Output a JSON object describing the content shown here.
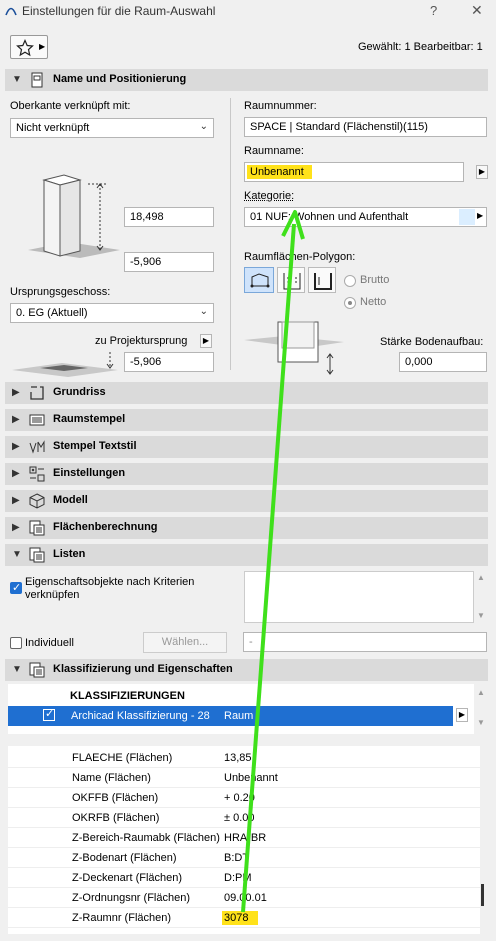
{
  "window": {
    "title": "Einstellungen für die Raum-Auswahl",
    "help": "?",
    "close": "✕"
  },
  "toolbar": {
    "selection_info": "Gewählt: 1 Bearbeitbar: 1"
  },
  "sections": {
    "name_pos": "Name und Positionierung",
    "grundriss": "Grundriss",
    "raumstempel": "Raumstempel",
    "stempel_textstil": "Stempel Textstil",
    "einstellungen": "Einstellungen",
    "modell": "Modell",
    "flaechenberechnung": "Flächenberechnung",
    "listen": "Listen",
    "klassifizierung": "Klassifizierung und Eigenschaften"
  },
  "name_pos": {
    "oberkante_label": "Oberkante verknüpft mit:",
    "oberkante_value": "Nicht verknüpft",
    "height_value": "18,498",
    "offset_value": "-5,906",
    "ursprung_label": "Ursprungsgeschoss:",
    "ursprung_value": "0. EG (Aktuell)",
    "projekt_label": "zu Projektursprung",
    "projekt_value": "-5,906",
    "raumnummer_label": "Raumnummer:",
    "raumnummer_value": "SPACE | Standard (Flächenstil)(115)",
    "raumname_label": "Raumname:",
    "raumname_value": "Unbenannt",
    "kategorie_label": "Kategorie:",
    "kategorie_value": "01 NUF: Wohnen und Aufenthalt",
    "polygon_label": "Raumflächen-Polygon:",
    "brutto_label": "Brutto",
    "netto_label": "Netto",
    "staerke_label": "Stärke Bodenaufbau:",
    "staerke_value": "0,000"
  },
  "listen": {
    "checkbox_label_1": "Eigenschaftsobjekte nach Kriterien",
    "checkbox_label_2": "verknüpfen",
    "individuell_label": "Individuell",
    "waehlen_label": "Wählen...",
    "dash_value": "-"
  },
  "klassifizierung": {
    "header": "KLASSIFIZIERUNGEN",
    "selected_name": "Archicad Klassifizierung - 28",
    "selected_value": "Raum",
    "properties": [
      {
        "name": "FLAECHE (Flächen)",
        "value": "13,85"
      },
      {
        "name": "Name (Flächen)",
        "value": "Unbenannt"
      },
      {
        "name": "OKFFB (Flächen)",
        "value": "+ 0.20"
      },
      {
        "name": "OKRFB (Flächen)",
        "value": "± 0.00"
      },
      {
        "name": "Z-Bereich-Raumabk (Flächen)",
        "value": "HRA-BR"
      },
      {
        "name": "Z-Bodenart (Flächen)",
        "value": "B:DT"
      },
      {
        "name": "Z-Deckenart (Flächen)",
        "value": "D:PM"
      },
      {
        "name": "Z-Ordnungsnr (Flächen)",
        "value": "09.00.01"
      },
      {
        "name": "Z-Raumnr (Flächen)",
        "value": "3078"
      }
    ]
  },
  "colors": {
    "highlight": "#ffe21a",
    "annotation_arrow": "#3fe01b",
    "selection": "#1f6fd1"
  }
}
